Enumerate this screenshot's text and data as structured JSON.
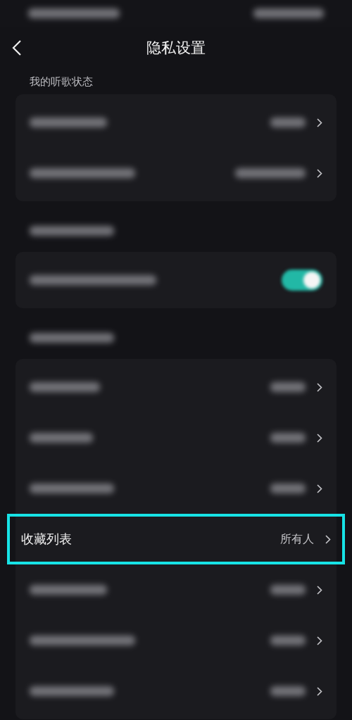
{
  "status_bar": {
    "blurred": true
  },
  "nav": {
    "title": "隐私设置"
  },
  "sections": [
    {
      "header": {
        "text": "我的听歌状态"
      },
      "rows": [
        {
          "kind": "link",
          "highlighted": false
        },
        {
          "kind": "link",
          "highlighted": false
        }
      ]
    },
    {
      "header": {
        "blurred": true
      },
      "rows": [
        {
          "kind": "toggle",
          "on": true
        }
      ]
    },
    {
      "header": {
        "blurred": true
      },
      "rows": [
        {
          "kind": "link",
          "highlighted": false
        },
        {
          "kind": "link",
          "highlighted": false
        },
        {
          "kind": "link",
          "highlighted": false
        },
        {
          "kind": "link",
          "label": "收藏列表",
          "value": "所有人",
          "highlighted": true
        },
        {
          "kind": "link",
          "highlighted": false
        },
        {
          "kind": "link",
          "highlighted": false
        },
        {
          "kind": "link",
          "highlighted": false
        }
      ]
    }
  ]
}
